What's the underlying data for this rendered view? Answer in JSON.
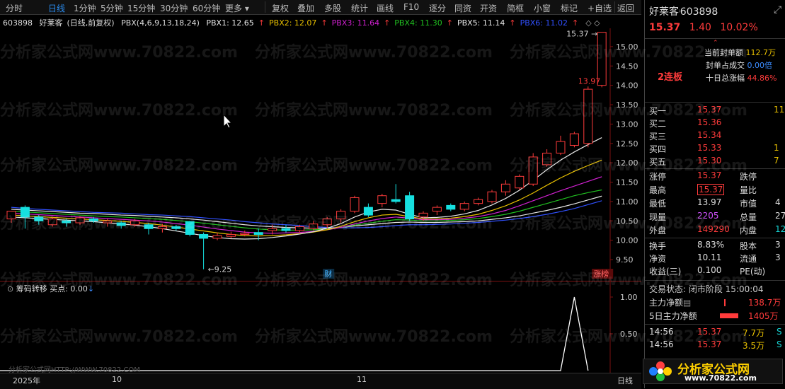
{
  "toolbar": {
    "items": [
      "分时",
      "日线",
      "1分钟",
      "5分钟",
      "15分钟",
      "30分钟",
      "60分钟",
      "更多",
      "复权",
      "叠加",
      "多股",
      "统计",
      "画线",
      "F10",
      "逐分",
      "同资",
      "开资",
      "简框",
      "小窗",
      "标记",
      "+自选",
      "返回"
    ],
    "active": "日线"
  },
  "info": {
    "code": "603898",
    "name": "好莱客",
    "period": "(日线,前复权)",
    "indicator": "PBX(4,6,9,13,18,24)",
    "pbx": [
      {
        "label": "PBX1: 12.65",
        "color": "#e8e8e8"
      },
      {
        "label": "PBX2: 12.07",
        "color": "#e8c000"
      },
      {
        "label": "PBX3: 11.64",
        "color": "#d020d0"
      },
      {
        "label": "PBX4: 11.30",
        "color": "#20c020"
      },
      {
        "label": "PBX5: 11.14",
        "color": "#e8e8e8"
      },
      {
        "label": "PBX6: 11.02",
        "color": "#3050ff"
      }
    ]
  },
  "chart_data": {
    "type": "candlestick",
    "y_ticks": [
      "15.00",
      "14.50",
      "14.00",
      "13.50",
      "13.00",
      "12.50",
      "12.00",
      "11.50",
      "11.00",
      "10.50",
      "10.00",
      "9.50"
    ],
    "ylim": [
      9.3,
      15.4
    ],
    "annotations": {
      "high": "15.37",
      "high2": "13.97",
      "low": "9.25",
      "fin": "财",
      "zt": "涨榜"
    },
    "x_labels": [
      "2025年",
      "10",
      "11"
    ],
    "candles": [
      [
        10.55,
        10.75,
        10.45,
        10.6
      ],
      [
        10.85,
        10.6,
        10.3,
        10.9
      ],
      [
        10.6,
        10.5,
        10.4,
        10.65
      ],
      [
        10.4,
        10.55,
        10.35,
        10.6
      ],
      [
        10.5,
        10.45,
        10.35,
        10.55
      ],
      [
        10.45,
        10.58,
        10.4,
        10.62
      ],
      [
        10.55,
        10.5,
        10.45,
        10.6
      ],
      [
        10.45,
        10.5,
        10.35,
        10.55
      ],
      [
        10.45,
        10.38,
        10.3,
        10.5
      ],
      [
        10.4,
        10.5,
        10.35,
        10.55
      ],
      [
        10.4,
        10.3,
        10.15,
        10.45
      ],
      [
        10.3,
        10.35,
        10.2,
        10.42
      ],
      [
        10.35,
        10.3,
        10.25,
        10.4
      ],
      [
        10.48,
        10.15,
        10.1,
        10.5
      ],
      [
        10.15,
        10.05,
        9.25,
        10.2
      ],
      [
        10.05,
        10.12,
        10.0,
        10.2
      ],
      [
        10.1,
        10.15,
        10.05,
        10.22
      ],
      [
        10.15,
        10.18,
        10.1,
        10.25
      ],
      [
        10.2,
        10.15,
        10.0,
        10.3
      ],
      [
        10.25,
        10.3,
        10.15,
        10.4
      ],
      [
        10.3,
        10.25,
        10.2,
        10.4
      ],
      [
        10.25,
        10.35,
        10.2,
        10.4
      ],
      [
        10.3,
        10.42,
        10.25,
        10.5
      ],
      [
        10.4,
        10.55,
        10.3,
        10.6
      ],
      [
        10.55,
        10.75,
        10.45,
        10.8
      ],
      [
        10.75,
        11.1,
        10.7,
        11.15
      ],
      [
        10.85,
        10.65,
        10.6,
        10.95
      ],
      [
        10.95,
        11.15,
        10.85,
        11.2
      ],
      [
        11.05,
        11.0,
        10.95,
        11.45
      ],
      [
        11.15,
        10.55,
        10.5,
        11.25
      ],
      [
        10.6,
        10.7,
        10.5,
        10.75
      ],
      [
        10.75,
        10.85,
        10.65,
        10.9
      ],
      [
        10.9,
        10.8,
        10.75,
        10.95
      ],
      [
        10.8,
        10.95,
        10.75,
        11.0
      ],
      [
        10.95,
        11.05,
        10.9,
        11.1
      ],
      [
        11.0,
        11.25,
        10.95,
        11.3
      ],
      [
        11.25,
        11.45,
        11.15,
        11.55
      ],
      [
        11.35,
        11.65,
        11.3,
        11.7
      ],
      [
        11.45,
        12.15,
        11.4,
        12.25
      ],
      [
        11.95,
        12.25,
        11.9,
        12.35
      ],
      [
        12.25,
        12.55,
        12.2,
        12.7
      ],
      [
        12.45,
        12.75,
        12.4,
        12.8
      ],
      [
        12.5,
        13.9,
        12.4,
        13.97
      ],
      [
        14.0,
        15.37,
        13.95,
        15.37
      ]
    ],
    "lines": [
      {
        "name": "PBX6",
        "color": "#3050ff",
        "values": [
          10.85,
          10.82,
          10.8,
          10.78,
          10.76,
          10.74,
          10.72,
          10.71,
          10.7,
          10.68,
          10.66,
          10.65,
          10.63,
          10.61,
          10.58,
          10.55,
          10.52,
          10.48,
          10.45,
          10.42,
          10.4,
          10.38,
          10.35,
          10.33,
          10.32,
          10.32,
          10.33,
          10.35,
          10.38,
          10.4,
          10.4,
          10.41,
          10.42,
          10.44,
          10.46,
          10.49,
          10.52,
          10.56,
          10.61,
          10.67,
          10.74,
          10.82,
          10.92,
          11.02
        ]
      },
      {
        "name": "PBX5",
        "color": "#e8e8e8",
        "values": [
          10.8,
          10.78,
          10.76,
          10.74,
          10.72,
          10.7,
          10.69,
          10.67,
          10.65,
          10.64,
          10.62,
          10.6,
          10.58,
          10.55,
          10.52,
          10.48,
          10.44,
          10.4,
          10.37,
          10.35,
          10.33,
          10.32,
          10.31,
          10.31,
          10.33,
          10.37,
          10.4,
          10.43,
          10.46,
          10.47,
          10.46,
          10.46,
          10.47,
          10.48,
          10.5,
          10.54,
          10.58,
          10.63,
          10.7,
          10.77,
          10.85,
          10.94,
          11.04,
          11.14
        ]
      },
      {
        "name": "PBX4",
        "color": "#20c020",
        "values": [
          10.75,
          10.73,
          10.71,
          10.69,
          10.67,
          10.65,
          10.63,
          10.61,
          10.6,
          10.58,
          10.56,
          10.54,
          10.51,
          10.48,
          10.44,
          10.4,
          10.36,
          10.32,
          10.29,
          10.27,
          10.26,
          10.26,
          10.27,
          10.29,
          10.33,
          10.39,
          10.44,
          10.49,
          10.53,
          10.52,
          10.5,
          10.5,
          10.51,
          10.53,
          10.56,
          10.61,
          10.67,
          10.75,
          10.85,
          10.95,
          11.05,
          11.15,
          11.23,
          11.3
        ]
      },
      {
        "name": "PBX3",
        "color": "#d020d0",
        "values": [
          10.7,
          10.68,
          10.66,
          10.64,
          10.62,
          10.6,
          10.58,
          10.56,
          10.54,
          10.52,
          10.5,
          10.47,
          10.43,
          10.39,
          10.34,
          10.29,
          10.25,
          10.21,
          10.19,
          10.18,
          10.19,
          10.2,
          10.23,
          10.27,
          10.33,
          10.42,
          10.5,
          10.56,
          10.6,
          10.57,
          10.53,
          10.53,
          10.54,
          10.57,
          10.61,
          10.68,
          10.77,
          10.89,
          11.02,
          11.15,
          11.28,
          11.4,
          11.52,
          11.64
        ]
      },
      {
        "name": "PBX2",
        "color": "#e8c000",
        "values": [
          10.65,
          10.63,
          10.61,
          10.59,
          10.57,
          10.55,
          10.53,
          10.51,
          10.49,
          10.46,
          10.43,
          10.39,
          10.34,
          10.29,
          10.24,
          10.19,
          10.15,
          10.12,
          10.11,
          10.12,
          10.14,
          10.17,
          10.21,
          10.27,
          10.36,
          10.48,
          10.58,
          10.65,
          10.67,
          10.61,
          10.55,
          10.55,
          10.57,
          10.61,
          10.67,
          10.77,
          10.89,
          11.04,
          11.22,
          11.42,
          11.61,
          11.78,
          11.93,
          12.07
        ]
      },
      {
        "name": "PBX1",
        "color": "#e8e8e8",
        "values": [
          10.6,
          10.58,
          10.56,
          10.54,
          10.52,
          10.5,
          10.48,
          10.45,
          10.42,
          10.39,
          10.35,
          10.3,
          10.24,
          10.18,
          10.12,
          10.07,
          10.04,
          10.03,
          10.04,
          10.07,
          10.11,
          10.16,
          10.22,
          10.31,
          10.43,
          10.6,
          10.73,
          10.8,
          10.78,
          10.67,
          10.58,
          10.59,
          10.62,
          10.68,
          10.77,
          10.91,
          11.08,
          11.29,
          11.55,
          11.82,
          12.07,
          12.28,
          12.47,
          12.65
        ]
      }
    ]
  },
  "indicator": {
    "title": "筹码转移",
    "buy_label": "买点: 0.00",
    "y_ticks": [
      "1.00",
      "0.50"
    ],
    "spike_index": 41
  },
  "bottom": {
    "period": "日线",
    "watermark_url": "分析家公式网HTTP://WWW.70822.COM"
  },
  "panel": {
    "name": "好莱客",
    "code": "603898",
    "price": "15.37",
    "change": "1.40",
    "pct": "10.02%",
    "badge": "2连板",
    "seal_label": "当前封单额",
    "seal_value": "112.7万",
    "seal_ratio_label": "封单占成交",
    "seal_ratio_value": "0.00倍",
    "ten_day_label": "十日总涨幅",
    "ten_day_value": "44.86%",
    "bids": [
      {
        "label": "买一",
        "price": "15.37",
        "vol": "11"
      },
      {
        "label": "买二",
        "price": "15.36",
        "vol": ""
      },
      {
        "label": "买三",
        "price": "15.34",
        "vol": ""
      },
      {
        "label": "买四",
        "price": "15.33",
        "vol": "1"
      },
      {
        "label": "买五",
        "price": "15.30",
        "vol": "7"
      }
    ],
    "stats": [
      {
        "l1": "涨停",
        "v1": "15.37",
        "l2": "跌停",
        "v2": ""
      },
      {
        "l1": "最高",
        "v1": "15.37",
        "l2": "量比",
        "v2": ""
      },
      {
        "l1": "最低",
        "v1": "13.97",
        "l2": "市值",
        "v2": "4"
      },
      {
        "l1": "现量",
        "v1": "2205",
        "l2": "总量",
        "v2": "27"
      },
      {
        "l1": "外盘",
        "v1": "149290",
        "l2": "内盘",
        "v2": "12"
      }
    ],
    "stats2": [
      {
        "l1": "换手",
        "v1": "8.83%",
        "l2": "股本",
        "v2": "3"
      },
      {
        "l1": "净资",
        "v1": "10.11",
        "l2": "流通",
        "v2": "3"
      },
      {
        "l1": "收益(三)",
        "v1": "0.100",
        "l2": "PE(动)",
        "v2": ""
      }
    ],
    "trade_state": "交易状态: 闭市阶段 15:00:04",
    "main_net_label": "主力净额",
    "main_net_value": "138.7万",
    "five_day_label": "5日主力净额",
    "five_day_value": "1405万",
    "ticks": [
      {
        "time": "14:56",
        "price": "15.37",
        "vol": "7.7万",
        "f": "S"
      },
      {
        "time": "14:56",
        "price": "15.37",
        "vol": "3.5万",
        "f": "S"
      }
    ],
    "logo_text": "分析家公式网",
    "logo_url": "www.70822.com"
  },
  "watermark": "分析家公式网www.70822.com"
}
